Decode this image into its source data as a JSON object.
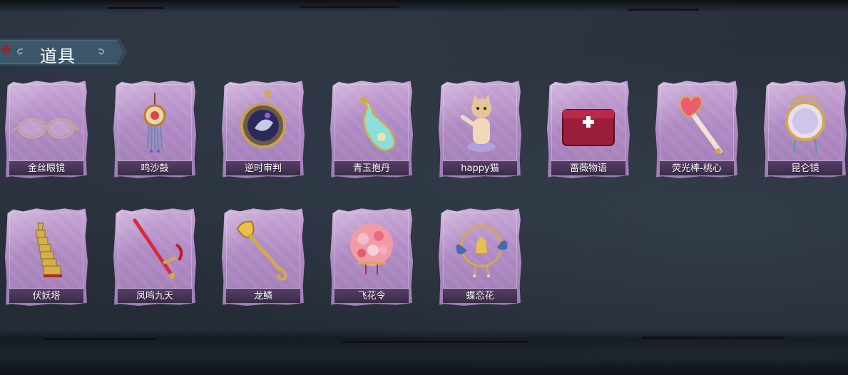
{
  "section": {
    "title": "道具"
  },
  "items": [
    {
      "label": "金丝眼镜",
      "icon": "glasses-icon"
    },
    {
      "label": "鸣沙鼓",
      "icon": "hand-drum-icon"
    },
    {
      "label": "逆时审判",
      "icon": "pocket-watch-icon"
    },
    {
      "label": "青玉抱丹",
      "icon": "jade-vase-icon"
    },
    {
      "label": "happy猫",
      "icon": "cat-figurine-icon"
    },
    {
      "label": "蔷薇物语",
      "icon": "medkit-icon"
    },
    {
      "label": "荧光棒-桃心",
      "icon": "heart-wand-icon"
    },
    {
      "label": "昆仑镜",
      "icon": "ornate-mirror-icon"
    },
    {
      "label": "伏妖塔",
      "icon": "pagoda-icon"
    },
    {
      "label": "凤鸣九天",
      "icon": "phoenix-sword-icon"
    },
    {
      "label": "龙鳞",
      "icon": "golden-shovel-icon"
    },
    {
      "label": "飞花令",
      "icon": "flower-bouquet-icon"
    },
    {
      "label": "蝶恋花",
      "icon": "butterfly-bell-icon"
    }
  ],
  "colors": {
    "background": "#27303b",
    "card_purple": "#b08ac4",
    "banner": "#3a5060",
    "label_text": "#ffffff"
  }
}
